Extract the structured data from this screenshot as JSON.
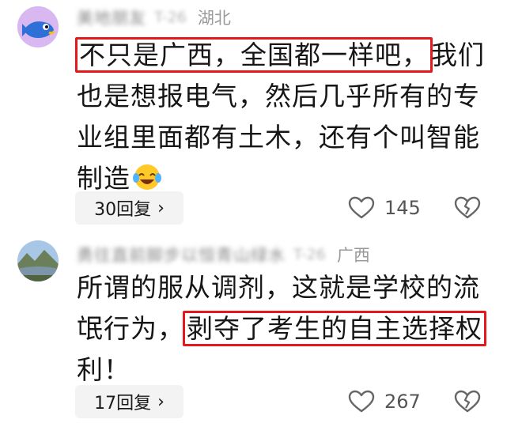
{
  "comments": [
    {
      "author_name": "美地朋友",
      "author_tag": "T-26",
      "location": "湖北",
      "text_highlighted": "不只是广西，全国都一样吧，",
      "text_rest": "我们也是想报电气，然后几乎所有的专业组里面都有土木，还有个叫智能制造",
      "emoji_icon": "laughing-crying-emoji-icon",
      "replies_label": "30回复",
      "like_count": "145"
    },
    {
      "author_name": "勇往直前脚步以恒青山绿水",
      "author_tag": "T-26",
      "location": "广西",
      "text_before": "所谓的服从调剂，这就是学校的流氓行为，",
      "text_highlighted": "剥夺了考生的自主选择权",
      "text_after": "利！",
      "replies_label": "17回复",
      "like_count": "267"
    }
  ],
  "colors": {
    "highlight_border": "#e5191b",
    "reply_bg": "#f3f3f3",
    "meta_text": "#9a9a9a"
  }
}
